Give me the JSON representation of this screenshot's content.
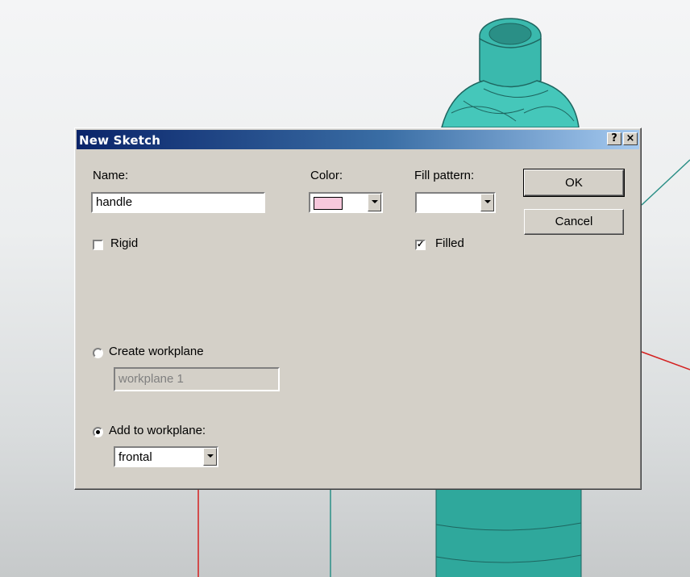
{
  "dialog": {
    "title": "New Sketch",
    "help_label": "?",
    "close_label": "×",
    "name_label": "Name:",
    "name_value": "handle",
    "color_label": "Color:",
    "color_swatch": "#f7c8dc",
    "fill_pattern_label": "Fill pattern:",
    "ok_label": "OK",
    "cancel_label": "Cancel",
    "rigid_label": "Rigid",
    "rigid_checked": false,
    "filled_label": "Filled",
    "filled_checked": true,
    "create_workplane_label": "Create workplane",
    "create_workplane_value": "workplane 1",
    "add_to_workplane_label": "Add to workplane:",
    "add_to_workplane_value": "frontal",
    "selected_option": "add_to_workplane"
  },
  "colors": {
    "model_teal": "#3ab9ad",
    "axis_red": "#d42020",
    "title_bar": "#0a246a"
  }
}
